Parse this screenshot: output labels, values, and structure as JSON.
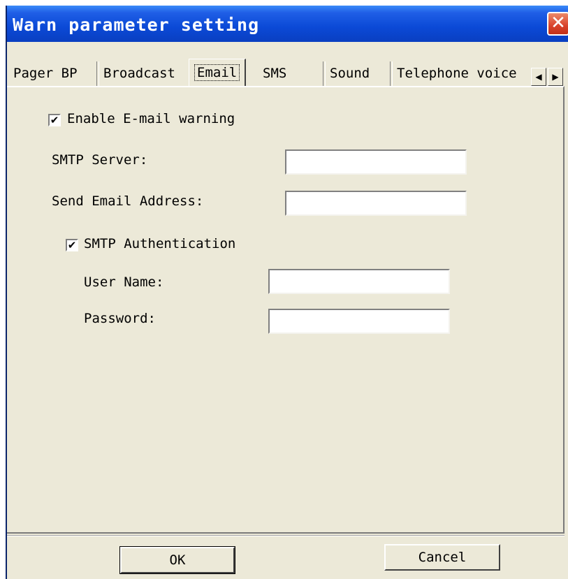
{
  "window": {
    "title": "Warn parameter setting",
    "close_icon": "close-icon"
  },
  "tabs": {
    "items": [
      {
        "label": "Pager BP"
      },
      {
        "label": "Broadcast"
      },
      {
        "label": "Email"
      },
      {
        "label": "SMS"
      },
      {
        "label": "Sound"
      },
      {
        "label": "Telephone voice"
      }
    ],
    "active": "Email",
    "scroll_left": "◀",
    "scroll_right": "▶"
  },
  "email": {
    "enable_checkbox": {
      "label": "Enable E-mail warning",
      "checked": true,
      "mark": "✔"
    },
    "smtp_server": {
      "label": "SMTP Server:",
      "value": ""
    },
    "send_address": {
      "label": "Send Email Address:",
      "value": ""
    },
    "auth_checkbox": {
      "label": "SMTP Authentication",
      "checked": true,
      "mark": "✔"
    },
    "user_name": {
      "label": "User Name:",
      "value": ""
    },
    "password": {
      "label": "Password:",
      "value": ""
    }
  },
  "buttons": {
    "ok": "OK",
    "cancel": "Cancel"
  },
  "colors": {
    "title_blue": "#0b49d6",
    "face": "#ece9d8",
    "close_red": "#d9432c"
  }
}
